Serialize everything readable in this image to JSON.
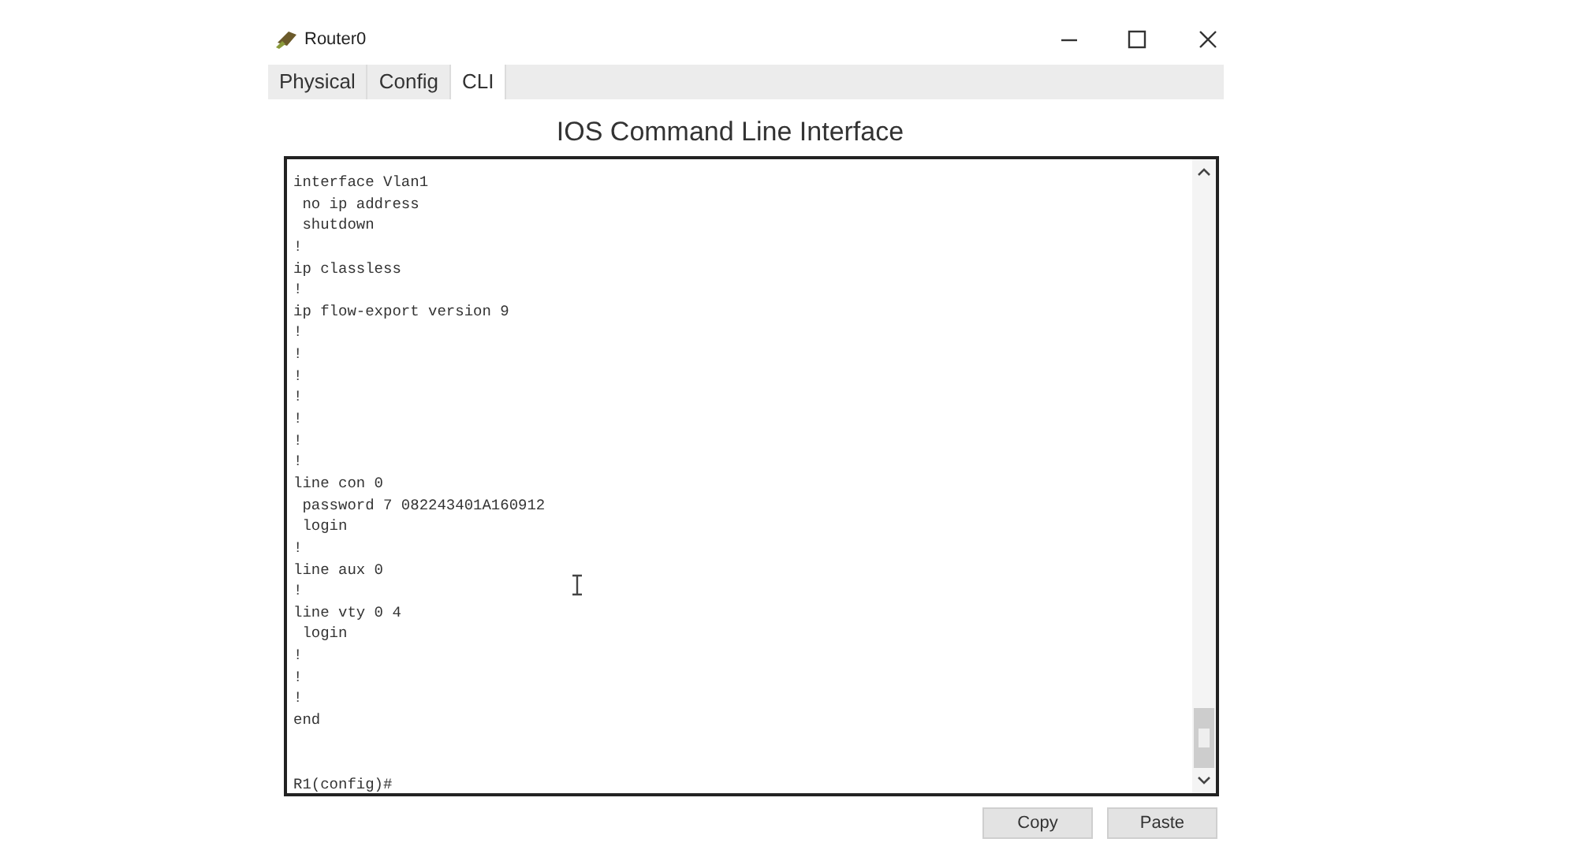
{
  "window": {
    "title": "Router0"
  },
  "tabs": [
    {
      "label": "Physical",
      "selected": false
    },
    {
      "label": "Config",
      "selected": false
    },
    {
      "label": "CLI",
      "selected": true
    }
  ],
  "heading": "IOS Command Line Interface",
  "terminal": {
    "lines": [
      "interface Vlan1",
      " no ip address",
      " shutdown",
      "!",
      "ip classless",
      "!",
      "ip flow-export version 9",
      "!",
      "!",
      "!",
      "!",
      "!",
      "!",
      "!",
      "line con 0",
      " password 7 082243401A160912",
      " login",
      "!",
      "line aux 0",
      "!",
      "line vty 0 4",
      " login",
      "!",
      "!",
      "!",
      "end"
    ],
    "prompt": "R1(config)#"
  },
  "buttons": [
    "Copy",
    "Paste"
  ]
}
